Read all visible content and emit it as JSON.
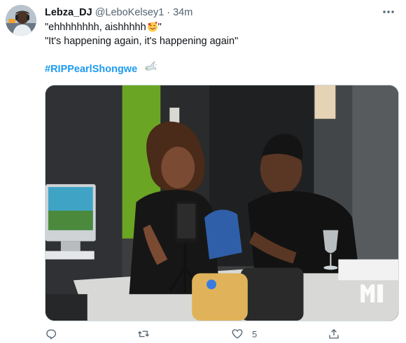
{
  "tweet": {
    "display_name": "Lebza_DJ",
    "handle": "@LeboKelsey1",
    "separator": "·",
    "time": "34m",
    "text_line_1": "\"ehhhhhhhh, aishhhhh",
    "text_line_1_end": "\"",
    "text_line_2": "\"It's happening again, it's happening again\"",
    "hashtag": "#RIPPearlShongwe",
    "emoji_1": "smiling-face-with-hearts-icon",
    "emoji_2": "dove-icon"
  },
  "media": {
    "watermark_text": "METRO FM"
  },
  "actions": {
    "reply_icon": "reply-icon",
    "retweet_icon": "retweet-icon",
    "like_icon": "heart-icon",
    "like_count": "5",
    "share_icon": "share-icon"
  },
  "colors": {
    "link": "#1d9bf0",
    "secondary_text": "#536471",
    "primary_text": "#0f1419"
  }
}
